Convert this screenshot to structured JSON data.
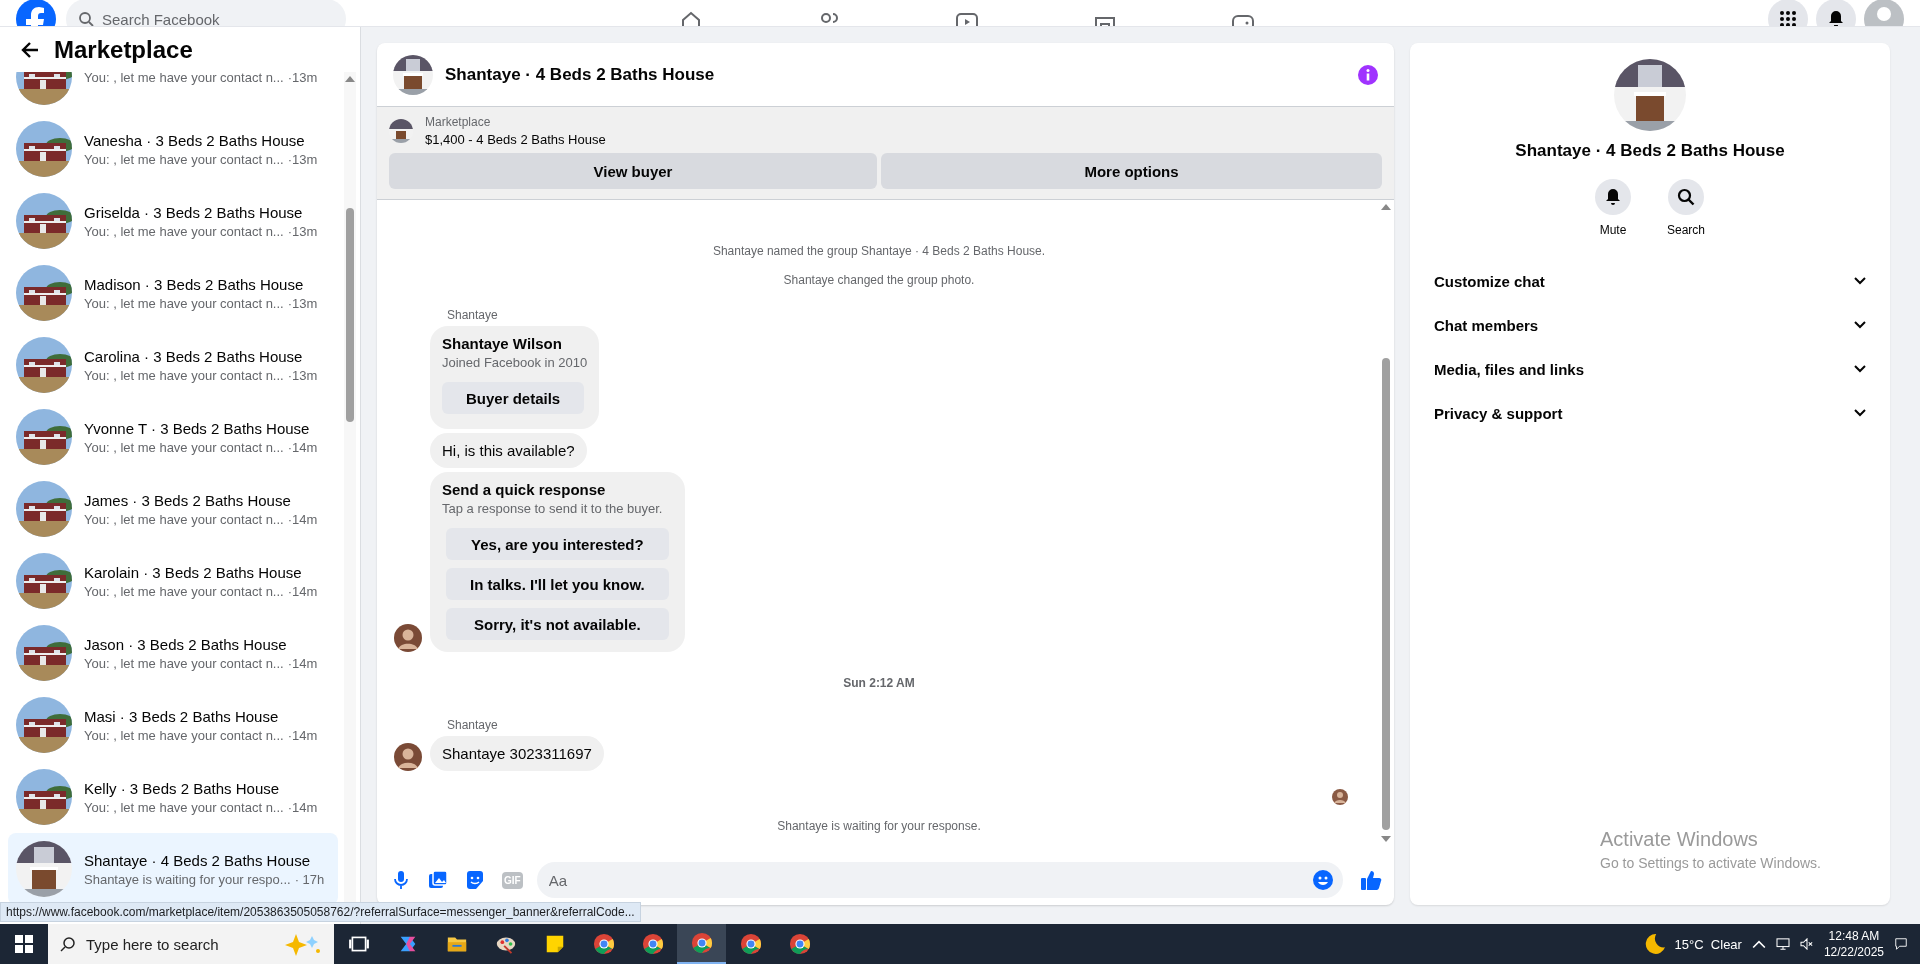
{
  "top_bar": {
    "search": {
      "placeholder": "Search Facebook"
    }
  },
  "sidebar": {
    "title": "Marketplace",
    "conversations": [
      {
        "preview": "You: , let me have your contact n...",
        "time": "·13m",
        "selected": false
      },
      {
        "name": "Vanesha · 3 Beds 2 Baths House",
        "preview": "You: , let me have your contact n...",
        "time": "·13m",
        "selected": false
      },
      {
        "name": "Griselda · 3 Beds 2 Baths House",
        "preview": "You: , let me have your contact n...",
        "time": "·13m",
        "selected": false
      },
      {
        "name": "Madison · 3 Beds 2 Baths House",
        "preview": "You: , let me have your contact n...",
        "time": "·13m",
        "selected": false
      },
      {
        "name": "Carolina · 3 Beds 2 Baths House",
        "preview": "You: , let me have your contact n...",
        "time": "·13m",
        "selected": false
      },
      {
        "name": "Yvonne T · 3 Beds 2 Baths House",
        "preview": "You: , let me have your contact n...",
        "time": "·14m",
        "selected": false
      },
      {
        "name": "James · 3 Beds 2 Baths House",
        "preview": "You: , let me have your contact n...",
        "time": "·14m",
        "selected": false
      },
      {
        "name": "Karolain · 3 Beds 2 Baths House",
        "preview": "You: , let me have your contact n...",
        "time": "·14m",
        "selected": false
      },
      {
        "name": "Jason · 3 Beds 2 Baths House",
        "preview": "You: , let me have your contact n...",
        "time": "·14m",
        "selected": false
      },
      {
        "name": "Masi · 3 Beds 2 Baths House",
        "preview": "You: , let me have your contact n...",
        "time": "·14m",
        "selected": false
      },
      {
        "name": "Kelly · 3 Beds 2 Baths House",
        "preview": "You: , let me have your contact n...",
        "time": "·14m",
        "selected": false
      },
      {
        "name": "Shantaye · 4 Beds 2 Baths House",
        "preview": "Shantaye is waiting for your respo...",
        "time": "· 17h",
        "selected": true
      }
    ]
  },
  "chat": {
    "title": "Shantaye · 4 Beds 2 Baths House",
    "listing": {
      "source": "Marketplace",
      "summary": "$1,400 - 4 Beds 2 Baths House"
    },
    "actions": [
      "View buyer",
      "More options"
    ],
    "messages": [
      {
        "kind": "system",
        "text": "Shantaye named the group Shantaye · 4 Beds 2 Baths House."
      },
      {
        "kind": "system",
        "text": "Shantaye changed the group photo."
      },
      {
        "kind": "sender",
        "text": "Shantaye"
      },
      {
        "kind": "profile_card",
        "title": "Shantaye Wilson",
        "subtitle": "Joined Facebook in 2010",
        "button": "Buyer details",
        "avatar": false
      },
      {
        "kind": "bubble",
        "text": "Hi, is this available?",
        "avatar": false
      },
      {
        "kind": "quick_response",
        "title": "Send a quick response",
        "subtitle": "Tap a response to send it to the buyer.",
        "options": [
          "Yes, are you interested?",
          "In talks. I'll let you know.",
          "Sorry, it's not available."
        ],
        "avatar": true
      },
      {
        "kind": "timestamp",
        "text": "Sun 2:12 AM"
      },
      {
        "kind": "sender",
        "text": "Shantaye"
      },
      {
        "kind": "bubble",
        "text": "Shantaye 3023311697",
        "avatar": true
      },
      {
        "kind": "seen"
      },
      {
        "kind": "system",
        "text": "Shantaye is waiting for your response."
      }
    ],
    "composer": {
      "gif_label": "GIF",
      "placeholder": "Aa"
    }
  },
  "details": {
    "title": "Shantaye · 4 Beds 2 Baths House",
    "actions": [
      {
        "kind": "mute",
        "label": "Mute"
      },
      {
        "kind": "search",
        "label": "Search"
      }
    ],
    "sections": [
      {
        "label": "Customize chat",
        "expanded": false
      },
      {
        "label": "Chat members",
        "expanded": false
      },
      {
        "label": "Media, files and links",
        "expanded": false
      },
      {
        "label": "Privacy & support",
        "expanded": false
      }
    ]
  },
  "status_url": "https://www.facebook.com/marketplace/item/2053863505058762/?referralSurface=messenger_banner&referralCode...",
  "activation_notice": {
    "title": "Activate Windows",
    "text": "Go to Settings to activate Windows."
  },
  "taskbar": {
    "search_placeholder": "Type here to search",
    "apps": [
      {
        "kind": "copilot",
        "selected": false
      },
      {
        "kind": "folder",
        "selected": false
      },
      {
        "kind": "paint",
        "selected": false
      },
      {
        "kind": "notes",
        "selected": false
      },
      {
        "kind": "chrome",
        "selected": false
      },
      {
        "kind": "chrome",
        "selected": false
      },
      {
        "kind": "chrome",
        "selected": true
      },
      {
        "kind": "chrome",
        "selected": false
      },
      {
        "kind": "chrome",
        "selected": false
      }
    ],
    "weather": "15°C  Clear",
    "time": "12:48 AM",
    "date": "12/22/2025"
  }
}
